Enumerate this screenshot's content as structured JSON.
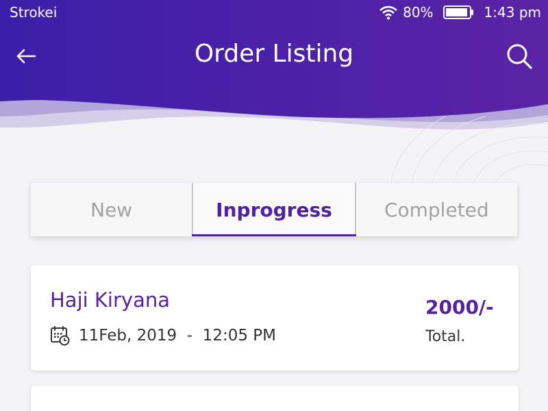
{
  "status_bar": {
    "carrier": "Strokei",
    "battery_percent": "80%",
    "time": "1:43 pm",
    "icons": [
      "wifi-icon",
      "battery-icon"
    ]
  },
  "header": {
    "title": "Order Listing",
    "back_icon": "back-arrow-icon",
    "search_icon": "search-icon",
    "gradient_colors": [
      "#3b1fa8",
      "#5b23a6"
    ]
  },
  "tabs": [
    {
      "label": "New",
      "active": false
    },
    {
      "label": "Inprogress",
      "active": true
    },
    {
      "label": "Completed",
      "active": false
    }
  ],
  "orders": [
    {
      "shop_name": "Haji Kiryana",
      "datetime": "11Feb, 2019  -  12:05 PM",
      "amount": "2000/-",
      "amount_label": "Total."
    }
  ],
  "colors": {
    "accent": "#4f22a0",
    "background": "#f4f4f6",
    "text": "#333333",
    "inactive_tab": "#a2a2a2"
  }
}
